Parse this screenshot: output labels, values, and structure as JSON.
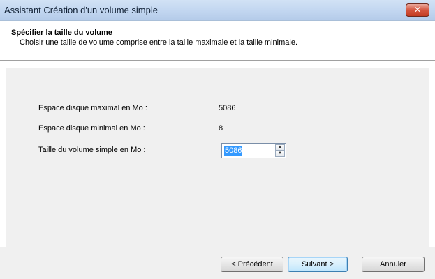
{
  "window": {
    "title": "Assistant Création d'un volume simple",
    "close_glyph": "✕"
  },
  "header": {
    "title": "Spécifier la taille du volume",
    "subtitle": "Choisir une taille de volume comprise entre la taille maximale et la taille minimale."
  },
  "fields": {
    "max_label": "Espace disque maximal en Mo :",
    "max_value": "5086",
    "min_label": "Espace disque minimal en Mo :",
    "min_value": "8",
    "size_label": "Taille du volume simple en Mo :",
    "size_value": "5086"
  },
  "spinner": {
    "up_glyph": "▲",
    "down_glyph": "▼"
  },
  "buttons": {
    "back": "< Précédent",
    "next": "Suivant >",
    "cancel": "Annuler"
  }
}
